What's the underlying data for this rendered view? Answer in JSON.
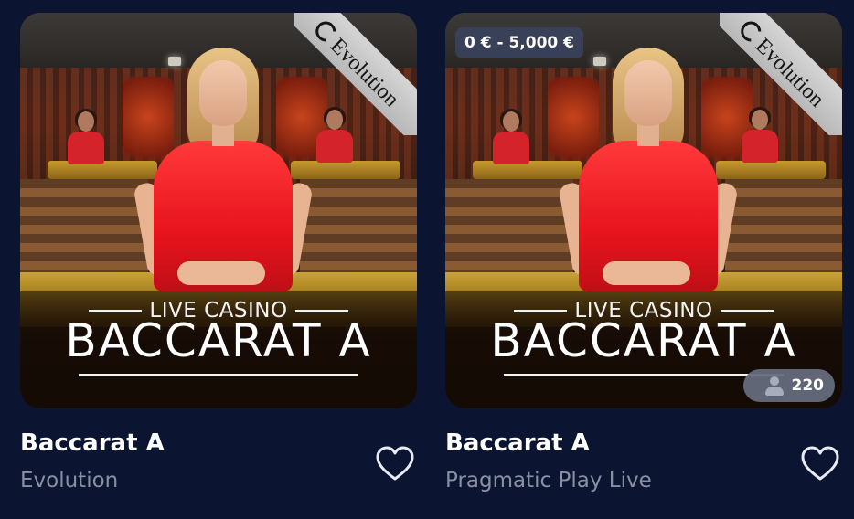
{
  "cards": [
    {
      "title": "Baccarat A",
      "provider": "Evolution",
      "art": {
        "subtitle": "LIVE CASINO",
        "headline": "BACCARAT A",
        "ribbon": "Evolution"
      },
      "icons": {
        "favorite": "heart-outline-icon"
      }
    },
    {
      "title": "Baccarat A",
      "provider": "Pragmatic Play Live",
      "bet_range": "0 € - 5,000 €",
      "players": "220",
      "art": {
        "subtitle": "LIVE CASINO",
        "headline": "BACCARAT A",
        "ribbon": "Evolution"
      },
      "icons": {
        "favorite": "heart-outline-icon",
        "players": "person-icon"
      }
    }
  ],
  "colors": {
    "background": "#0b1430",
    "title": "#ffffff",
    "provider": "#8a8fa3",
    "dress": "#e8141e"
  }
}
